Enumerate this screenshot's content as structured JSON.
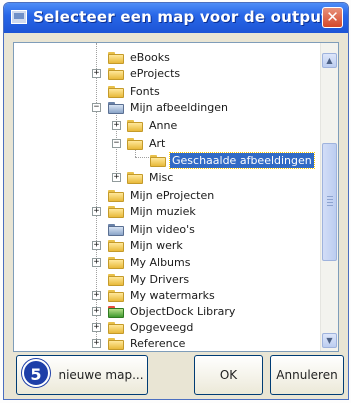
{
  "window": {
    "title": "Selecteer een map voor de output:",
    "close_label": "✕"
  },
  "tree": {
    "items": [
      {
        "label": "eBooks",
        "icon": "folder-icon"
      },
      {
        "label": "eProjects",
        "icon": "folder-icon"
      },
      {
        "label": "Fonts",
        "icon": "folder-icon"
      },
      {
        "label": "Mijn afbeeldingen",
        "icon": "pictures-folder-icon"
      },
      {
        "label": "Anne",
        "icon": "folder-icon"
      },
      {
        "label": "Art",
        "icon": "folder-icon"
      },
      {
        "label": "Geschaalde afbeeldingen",
        "icon": "folder-icon",
        "selected": true
      },
      {
        "label": "Misc",
        "icon": "folder-icon"
      },
      {
        "label": "Mijn eProjecten",
        "icon": "folder-icon"
      },
      {
        "label": "Mijn muziek",
        "icon": "folder-icon"
      },
      {
        "label": "Mijn video's",
        "icon": "video-folder-icon"
      },
      {
        "label": "Mijn werk",
        "icon": "folder-icon"
      },
      {
        "label": "My Albums",
        "icon": "folder-icon"
      },
      {
        "label": "My Drivers",
        "icon": "folder-icon"
      },
      {
        "label": "My watermarks",
        "icon": "folder-icon"
      },
      {
        "label": "ObjectDock Library",
        "icon": "objectdock-icon"
      },
      {
        "label": "Opgeveegd",
        "icon": "folder-icon"
      },
      {
        "label": "Reference",
        "icon": "folder-icon"
      }
    ]
  },
  "buttons": {
    "step_badge": "5",
    "new_folder": "nieuwe map...",
    "ok": "OK",
    "cancel": "Annuleren"
  }
}
